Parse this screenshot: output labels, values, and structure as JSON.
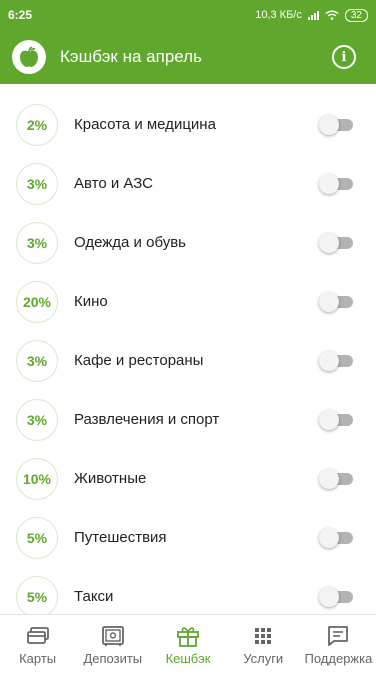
{
  "status_bar": {
    "time": "6:25",
    "network_speed": "10,3 КБ/с",
    "battery": "32"
  },
  "header": {
    "title": "Кэшбэк на апрель",
    "logo_icon": "apple-icon",
    "info_icon": "info-icon",
    "info_glyph": "i"
  },
  "categories": [
    {
      "percent": "2%",
      "label": "Красота и медицина",
      "enabled": false
    },
    {
      "percent": "3%",
      "label": "Авто и АЗС",
      "enabled": false
    },
    {
      "percent": "3%",
      "label": "Одежда и обувь",
      "enabled": false
    },
    {
      "percent": "20%",
      "label": "Кино",
      "enabled": false
    },
    {
      "percent": "3%",
      "label": "Кафе и рестораны",
      "enabled": false
    },
    {
      "percent": "3%",
      "label": "Развлечения и спорт",
      "enabled": false
    },
    {
      "percent": "10%",
      "label": "Животные",
      "enabled": false
    },
    {
      "percent": "5%",
      "label": "Путешествия",
      "enabled": false
    },
    {
      "percent": "5%",
      "label": "Такси",
      "enabled": false
    }
  ],
  "bottom_nav": [
    {
      "label": "Карты",
      "icon": "cards-icon",
      "active": false
    },
    {
      "label": "Депозиты",
      "icon": "safe-icon",
      "active": false
    },
    {
      "label": "Кешбэк",
      "icon": "gift-icon",
      "active": true
    },
    {
      "label": "Услуги",
      "icon": "grid-icon",
      "active": false
    },
    {
      "label": "Поддержка",
      "icon": "chat-icon",
      "active": false
    }
  ],
  "colors": {
    "accent": "#5fa82d",
    "toggle_off_track": "#b3b3b3",
    "nav_inactive": "#666666"
  }
}
